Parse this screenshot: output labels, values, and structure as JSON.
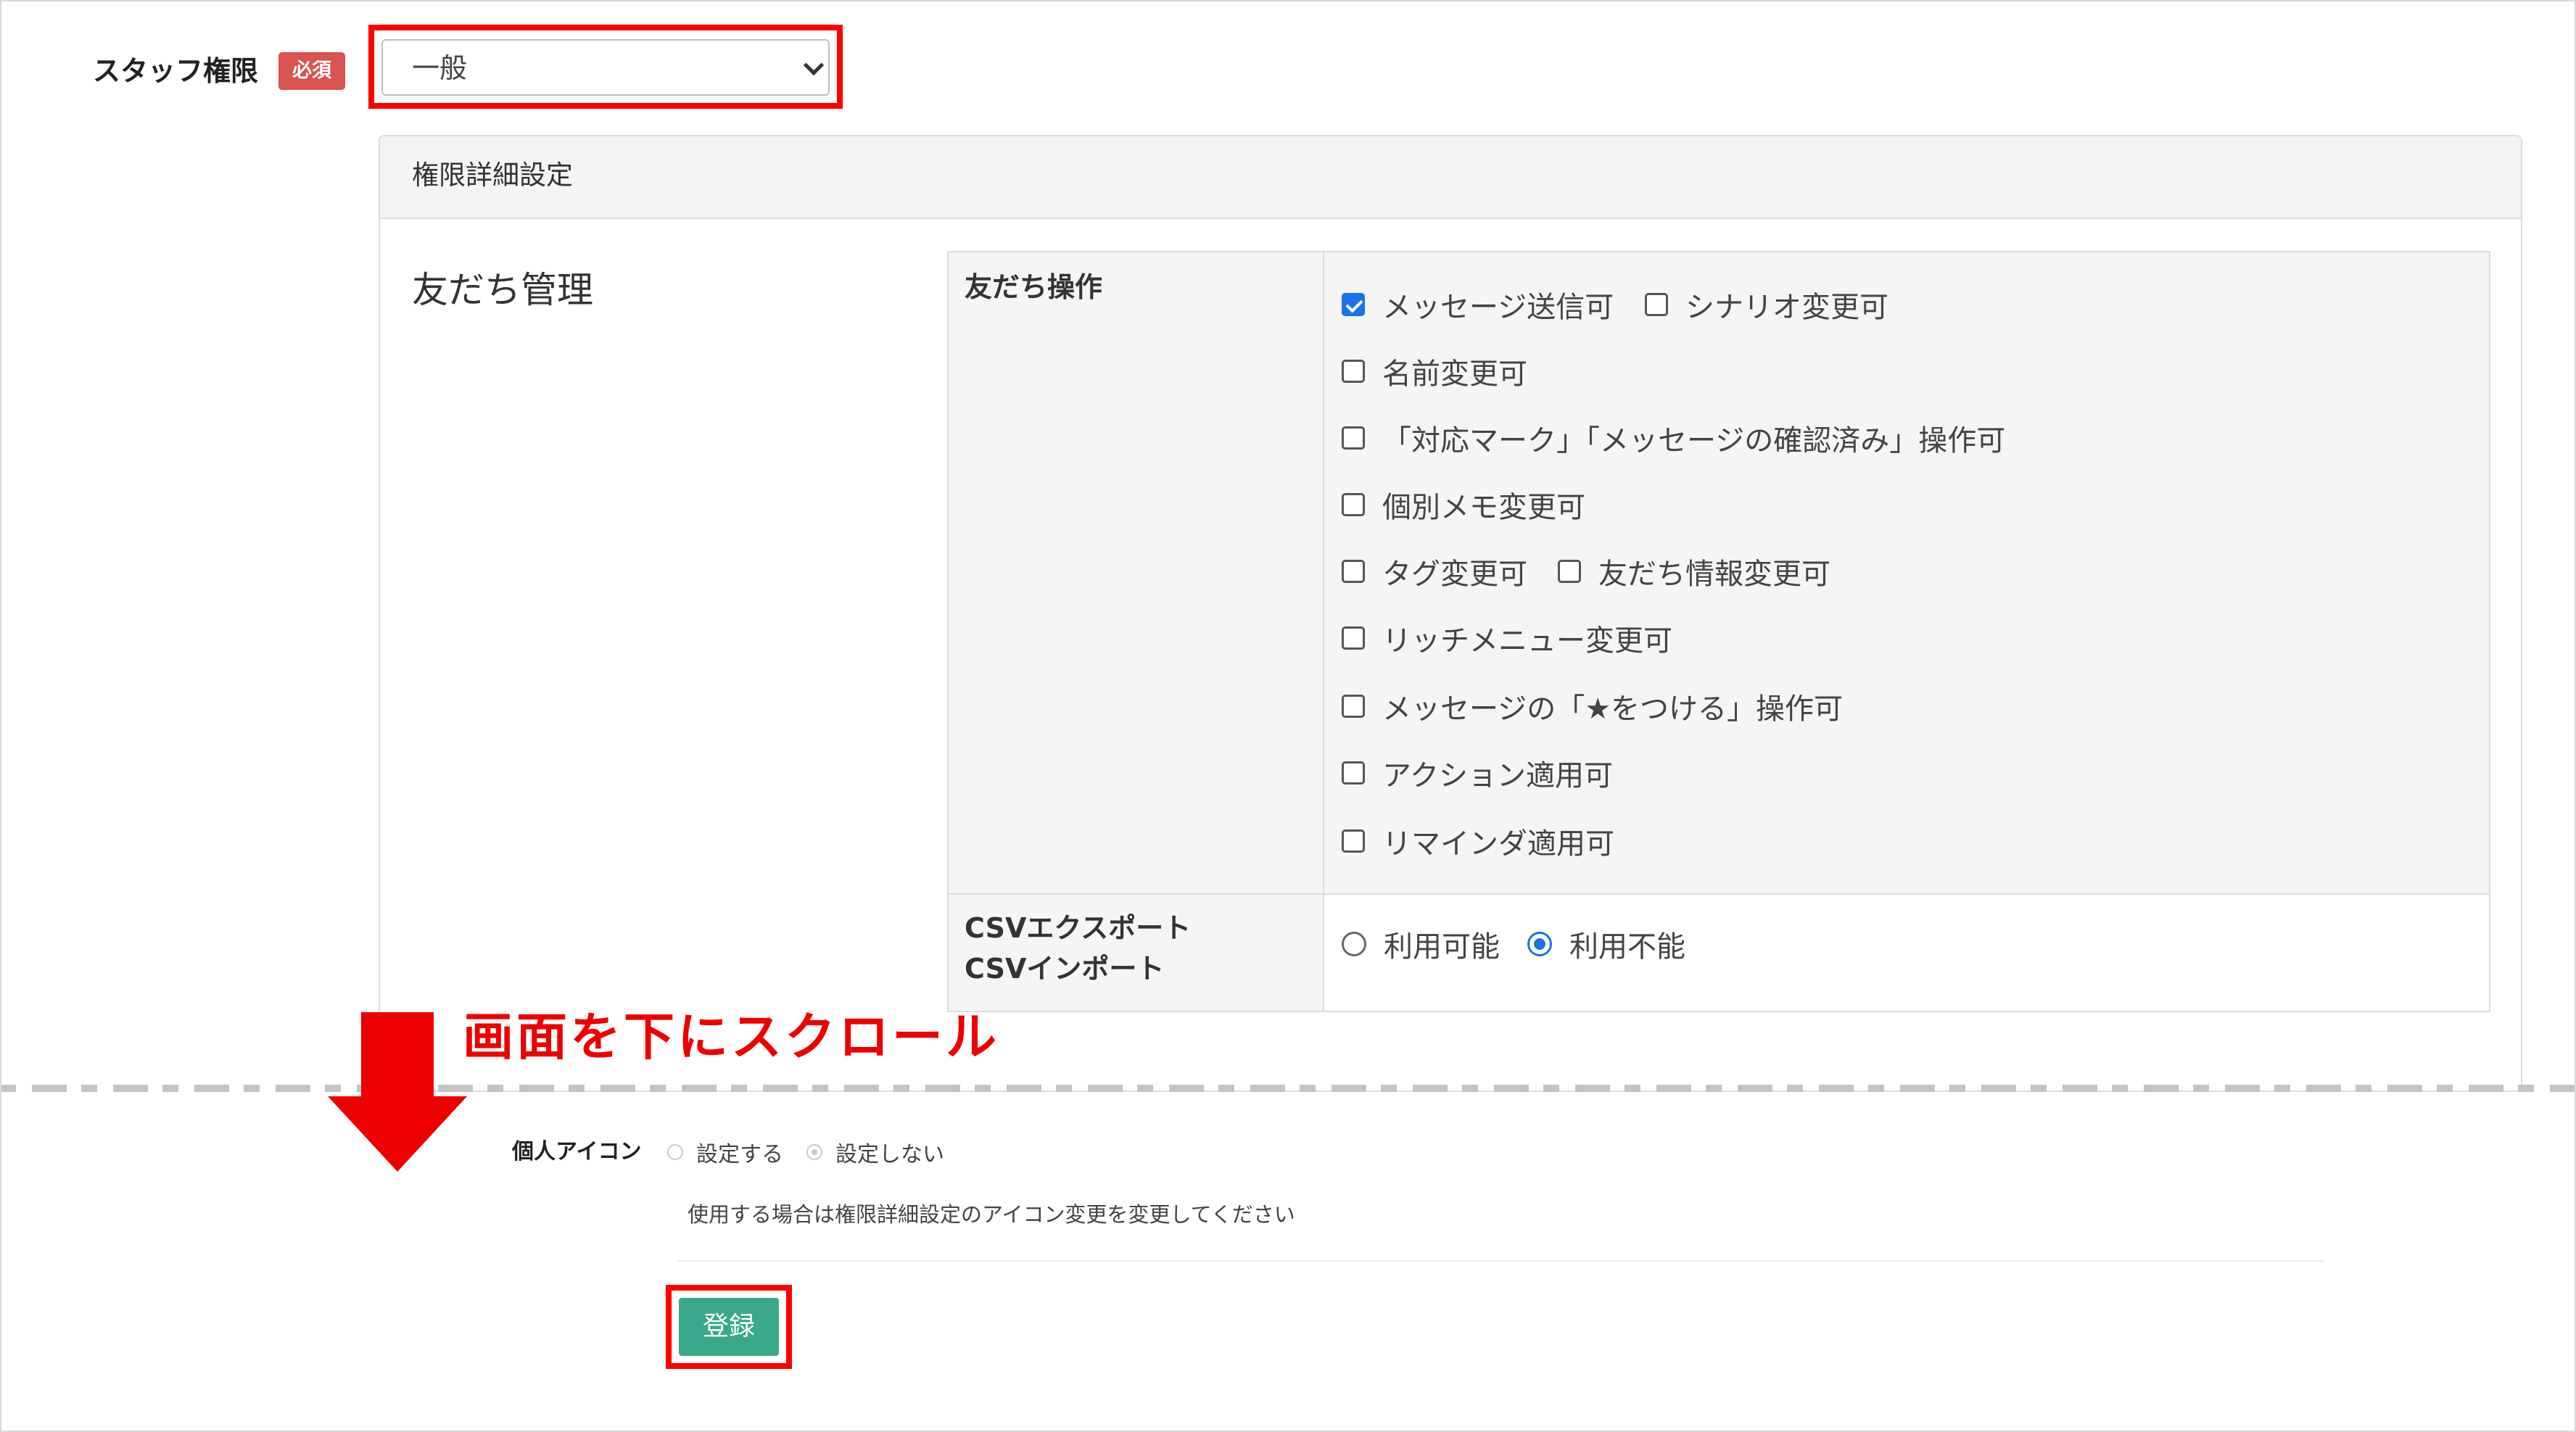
{
  "staff": {
    "label": "スタッフ権限",
    "required_badge": "必須",
    "select_value": "一般"
  },
  "panel": {
    "title": "権限詳細設定",
    "section_title": "友だち管理"
  },
  "friend_ops": {
    "label": "友だち操作",
    "options": [
      {
        "label": "メッセージ送信可",
        "checked": true
      },
      {
        "label": "シナリオ変更可",
        "checked": false
      },
      {
        "label": "名前変更可",
        "checked": false
      },
      {
        "label": "「対応マーク」「メッセージの確認済み」操作可",
        "checked": false
      },
      {
        "label": "個別メモ変更可",
        "checked": false
      },
      {
        "label": "タグ変更可",
        "checked": false
      },
      {
        "label": "友だち情報変更可",
        "checked": false
      },
      {
        "label": "リッチメニュー変更可",
        "checked": false
      },
      {
        "label": "メッセージの「★をつける」操作可",
        "checked": false
      },
      {
        "label": "アクション適用可",
        "checked": false
      },
      {
        "label": "リマインダ適用可",
        "checked": false
      }
    ]
  },
  "csv": {
    "label_line1": "CSVエクスポート",
    "label_line2": "CSVインポート",
    "options": [
      {
        "label": "利用可能",
        "checked": false
      },
      {
        "label": "利用不能",
        "checked": true
      }
    ]
  },
  "annotation": {
    "scroll_text": "画面を下にスクロール",
    "color": "#ee0000"
  },
  "personal_icon": {
    "label": "個人アイコン",
    "options": [
      {
        "label": "設定する",
        "checked": false
      },
      {
        "label": "設定しない",
        "checked": true
      }
    ],
    "hint": "使用する場合は権限詳細設定のアイコン変更を変更してください"
  },
  "register_button": {
    "label": "登録",
    "color": "#3aa88a"
  }
}
